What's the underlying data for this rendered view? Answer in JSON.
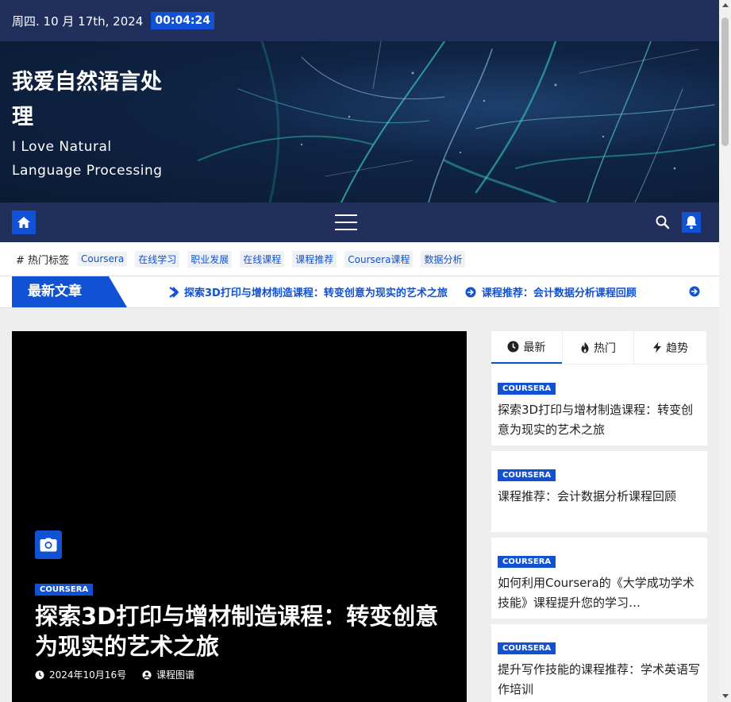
{
  "topbar": {
    "date": "周四. 10 月 17th, 2024",
    "clock": "00:04:24"
  },
  "site": {
    "title": "我爱自然语言处理",
    "tagline": "I Love Natural Language Processing"
  },
  "nav": {
    "home_icon": "home-icon",
    "menu_icon": "hamburger-menu-icon",
    "search_icon": "search-icon",
    "bell_icon": "bell-icon"
  },
  "tags": {
    "label": "# 热门标签",
    "items": [
      "Coursera",
      "在线学习",
      "职业发展",
      "在线课程",
      "课程推荐",
      "Coursera课程",
      "数据分析"
    ]
  },
  "latest": {
    "label": "最新文章",
    "items": [
      "探索3D打印与增材制造课程：转变创意为现实的艺术之旅",
      "课程推荐：会计数据分析课程回顾"
    ]
  },
  "feature": {
    "category": "COURSERA",
    "title": "探索3D打印与增材制造课程：转变创意为现实的艺术之旅",
    "date": "2024年10月16号",
    "author": "课程图谱"
  },
  "sidebar": {
    "tabs": [
      {
        "label": "最新",
        "icon": "clock-icon"
      },
      {
        "label": "热门",
        "icon": "fire-icon"
      },
      {
        "label": "趋势",
        "icon": "bolt-icon"
      }
    ],
    "posts": [
      {
        "category": "COURSERA",
        "title": "探索3D打印与增材制造课程：转变创意为现实的艺术之旅"
      },
      {
        "category": "COURSERA",
        "title": "课程推荐：会计数据分析课程回顾"
      },
      {
        "category": "COURSERA",
        "title": "如何利用Coursera的《大学成功学术技能》课程提升您的学习…"
      },
      {
        "category": "COURSERA",
        "title": "提升写作技能的课程推荐：学术英语写作培训"
      }
    ]
  },
  "colors": {
    "primary": "#1151d3",
    "navy": "#202f5b"
  }
}
